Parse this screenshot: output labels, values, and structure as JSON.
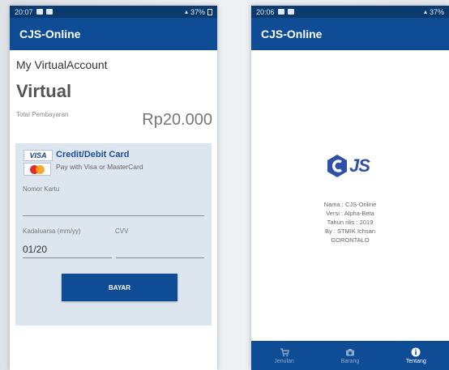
{
  "left": {
    "status": {
      "time": "20:07",
      "right_text": "37%"
    },
    "appbar": {
      "title": "CJS-Online"
    },
    "va_title": "My VirtualAccount",
    "va_big": "Virtual",
    "total_label": "Total Pembayaran",
    "total_value": "Rp20.000",
    "card": {
      "visa_text": "VISA",
      "title": "Credit/Debit Card",
      "subtitle": "Pay with Visa or MasterCard",
      "card_number_label": "Nomor Kartu",
      "card_number_value": "",
      "expiry_label": "Kadaluarsa (mm/yy)",
      "expiry_value": "01/20",
      "cvv_label": "CVV",
      "cvv_value": "",
      "pay_label": "BAYAR"
    }
  },
  "right": {
    "status": {
      "time": "20:06",
      "right_text": "37%"
    },
    "appbar": {
      "title": "CJS-Online"
    },
    "logo_text": "JS",
    "about": {
      "line1": "Nama : CJS-Online",
      "line2": "Versi : Alpha-Beta",
      "line3": "Tahun rilis : 2019",
      "line4": "By : STMIK Ichsan",
      "line5": "GORONTALO"
    },
    "nav": [
      {
        "label": "Jenulan",
        "icon": "cart-icon"
      },
      {
        "label": "Barang",
        "icon": "camera-icon"
      },
      {
        "label": "Tentang",
        "icon": "info-icon"
      }
    ]
  },
  "colors": {
    "primary": "#0e4d95",
    "status_bar": "#0b3a6e",
    "card_panel": "#dde5ef"
  }
}
